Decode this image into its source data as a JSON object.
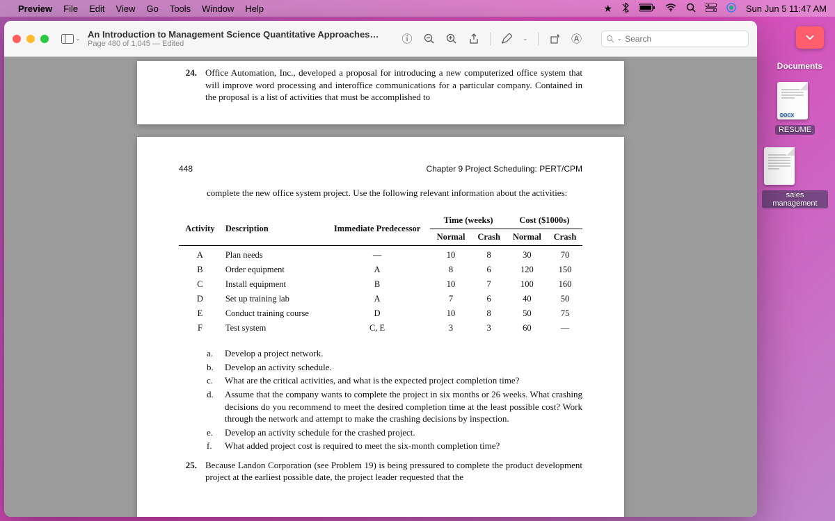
{
  "menubar": {
    "app": "Preview",
    "items": [
      "File",
      "Edit",
      "View",
      "Go",
      "Tools",
      "Window",
      "Help"
    ],
    "clock": "Sun Jun 5  11:47 AM"
  },
  "toolbar": {
    "title": "An Introduction to Management Science Quantitative Approaches to De…",
    "subtitle": "Page 480 of 1,045 — Edited",
    "search_placeholder": "Search"
  },
  "doc": {
    "q24_num": "24.",
    "q24_text": "Office Automation, Inc., developed a proposal for introducing a new computerized office system that will improve word processing and interoffice communications for a particular company. Contained in the proposal is a list of activities that must be accomplished to",
    "page_num": "448",
    "chapter": "Chapter 9   Project Scheduling: PERT/CPM",
    "continuation": "complete the new office system project. Use the following relevant information about the activities:",
    "table": {
      "head_activity": "Activity",
      "head_desc": "Description",
      "head_pred": "Immediate Predecessor",
      "group_time": "Time (weeks)",
      "group_cost": "Cost ($1000s)",
      "head_normal": "Normal",
      "head_crash": "Crash",
      "rows": [
        {
          "a": "A",
          "d": "Plan needs",
          "p": "—",
          "tn": "10",
          "tc": "8",
          "cn": "30",
          "cc": "70"
        },
        {
          "a": "B",
          "d": "Order equipment",
          "p": "A",
          "tn": "8",
          "tc": "6",
          "cn": "120",
          "cc": "150"
        },
        {
          "a": "C",
          "d": "Install equipment",
          "p": "B",
          "tn": "10",
          "tc": "7",
          "cn": "100",
          "cc": "160"
        },
        {
          "a": "D",
          "d": "Set up training lab",
          "p": "A",
          "tn": "7",
          "tc": "6",
          "cn": "40",
          "cc": "50"
        },
        {
          "a": "E",
          "d": "Conduct training course",
          "p": "D",
          "tn": "10",
          "tc": "8",
          "cn": "50",
          "cc": "75"
        },
        {
          "a": "F",
          "d": "Test system",
          "p": "C, E",
          "tn": "3",
          "tc": "3",
          "cn": "60",
          "cc": "—"
        }
      ]
    },
    "subs": [
      {
        "l": "a.",
        "t": "Develop a project network."
      },
      {
        "l": "b.",
        "t": "Develop an activity schedule."
      },
      {
        "l": "c.",
        "t": "What are the critical activities, and what is the expected project completion time?"
      },
      {
        "l": "d.",
        "t": "Assume that the company wants to complete the project in six months or 26 weeks. What crashing decisions do you recommend to meet the desired completion time at the least possible cost? Work through the network and attempt to make the crashing decisions by inspection."
      },
      {
        "l": "e.",
        "t": "Develop an activity schedule for the crashed project."
      },
      {
        "l": "f.",
        "t": "What added project cost is required to meet the six-month completion time?"
      }
    ],
    "q25_num": "25.",
    "q25_text": "Because Landon Corporation (see Problem 19) is being pressured to complete the product development project at the earliest possible date, the project leader requested that the"
  },
  "desktop": {
    "section": "Documents",
    "items": [
      {
        "name": "RESUME",
        "badge": "DOCX"
      },
      {
        "name": "sales management",
        "badge": ""
      }
    ]
  }
}
